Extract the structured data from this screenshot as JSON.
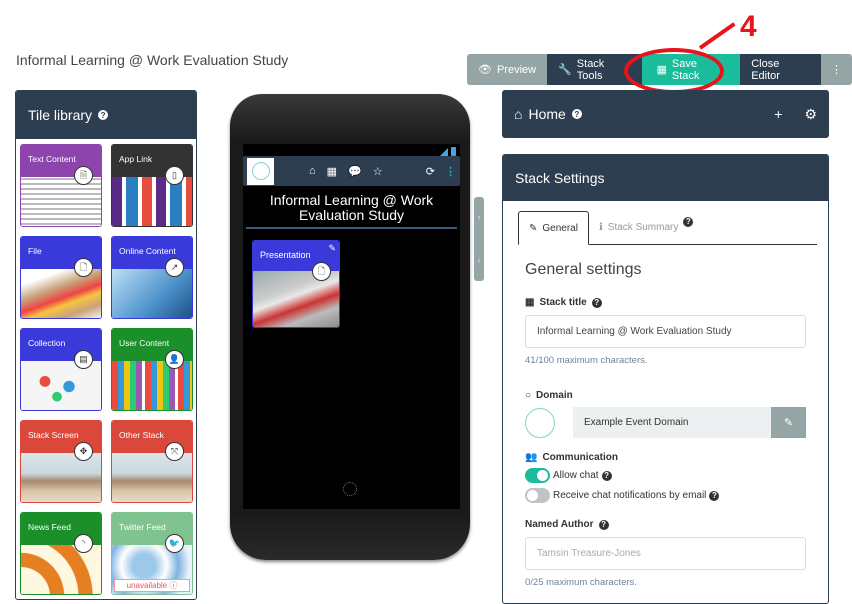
{
  "page": {
    "title": "Informal Learning @ Work Evaluation Study"
  },
  "toolbar": {
    "preview": "Preview",
    "stack_tools": "Stack Tools",
    "save_stack": "Save Stack",
    "close_editor": "Close Editor",
    "more": "⋮"
  },
  "annotation": {
    "step": "4",
    "color": "#e8141b"
  },
  "tile_library": {
    "title": "Tile library",
    "tiles": [
      {
        "label": "Text Content",
        "icon": "file-text-icon",
        "glyph": "🗎",
        "color": "#8e44ad"
      },
      {
        "label": "App Link",
        "icon": "mobile-icon",
        "glyph": "▯",
        "color": "#333333"
      },
      {
        "label": "File",
        "icon": "file-icon",
        "glyph": "🗋",
        "color": "#3a3adb"
      },
      {
        "label": "Online Content",
        "icon": "external-link-icon",
        "glyph": "↗",
        "color": "#3a3adb"
      },
      {
        "label": "Collection",
        "icon": "list-icon",
        "glyph": "▤",
        "color": "#3a3adb"
      },
      {
        "label": "User Content",
        "icon": "user-icon",
        "glyph": "👤",
        "color": "#1a8f2a"
      },
      {
        "label": "Stack Screen",
        "icon": "arrows-icon",
        "glyph": "✥",
        "color": "#d9483b"
      },
      {
        "label": "Other Stack",
        "icon": "expand-icon",
        "glyph": "⤧",
        "color": "#d9483b"
      },
      {
        "label": "News Feed",
        "icon": "rss-icon",
        "glyph": "◝",
        "color": "#1a8f2a"
      },
      {
        "label": "Twitter Feed",
        "icon": "twitter-icon",
        "glyph": "🐦",
        "color": "#7fc48e",
        "badge": "unavailable ⓘ"
      }
    ]
  },
  "phone": {
    "screen_title": "Informal Learning @ Work Evaluation Study",
    "tile": {
      "label": "Presentation"
    },
    "nav": [
      "home",
      "grid",
      "chat",
      "star"
    ]
  },
  "home_panel": {
    "title": "Home"
  },
  "settings": {
    "title": "Stack Settings",
    "tabs": [
      {
        "label": "General",
        "active": true
      },
      {
        "label": "Stack Summary",
        "active": false
      }
    ],
    "section_title": "General settings",
    "stack_title_label": "Stack title",
    "stack_title_value": "Informal Learning @ Work Evaluation Study",
    "stack_title_hint": "41/100 maximum characters.",
    "domain_label": "Domain",
    "domain_value": "Example Event Domain",
    "communication_label": "Communication",
    "allow_chat_label": "Allow chat",
    "allow_chat_on": true,
    "email_notif_label": "Receive chat notifications by email",
    "email_notif_on": false,
    "named_author_label": "Named Author",
    "named_author_placeholder": "Tamsin Treasure-Jones",
    "named_author_hint": "0/25 maximum characters."
  }
}
